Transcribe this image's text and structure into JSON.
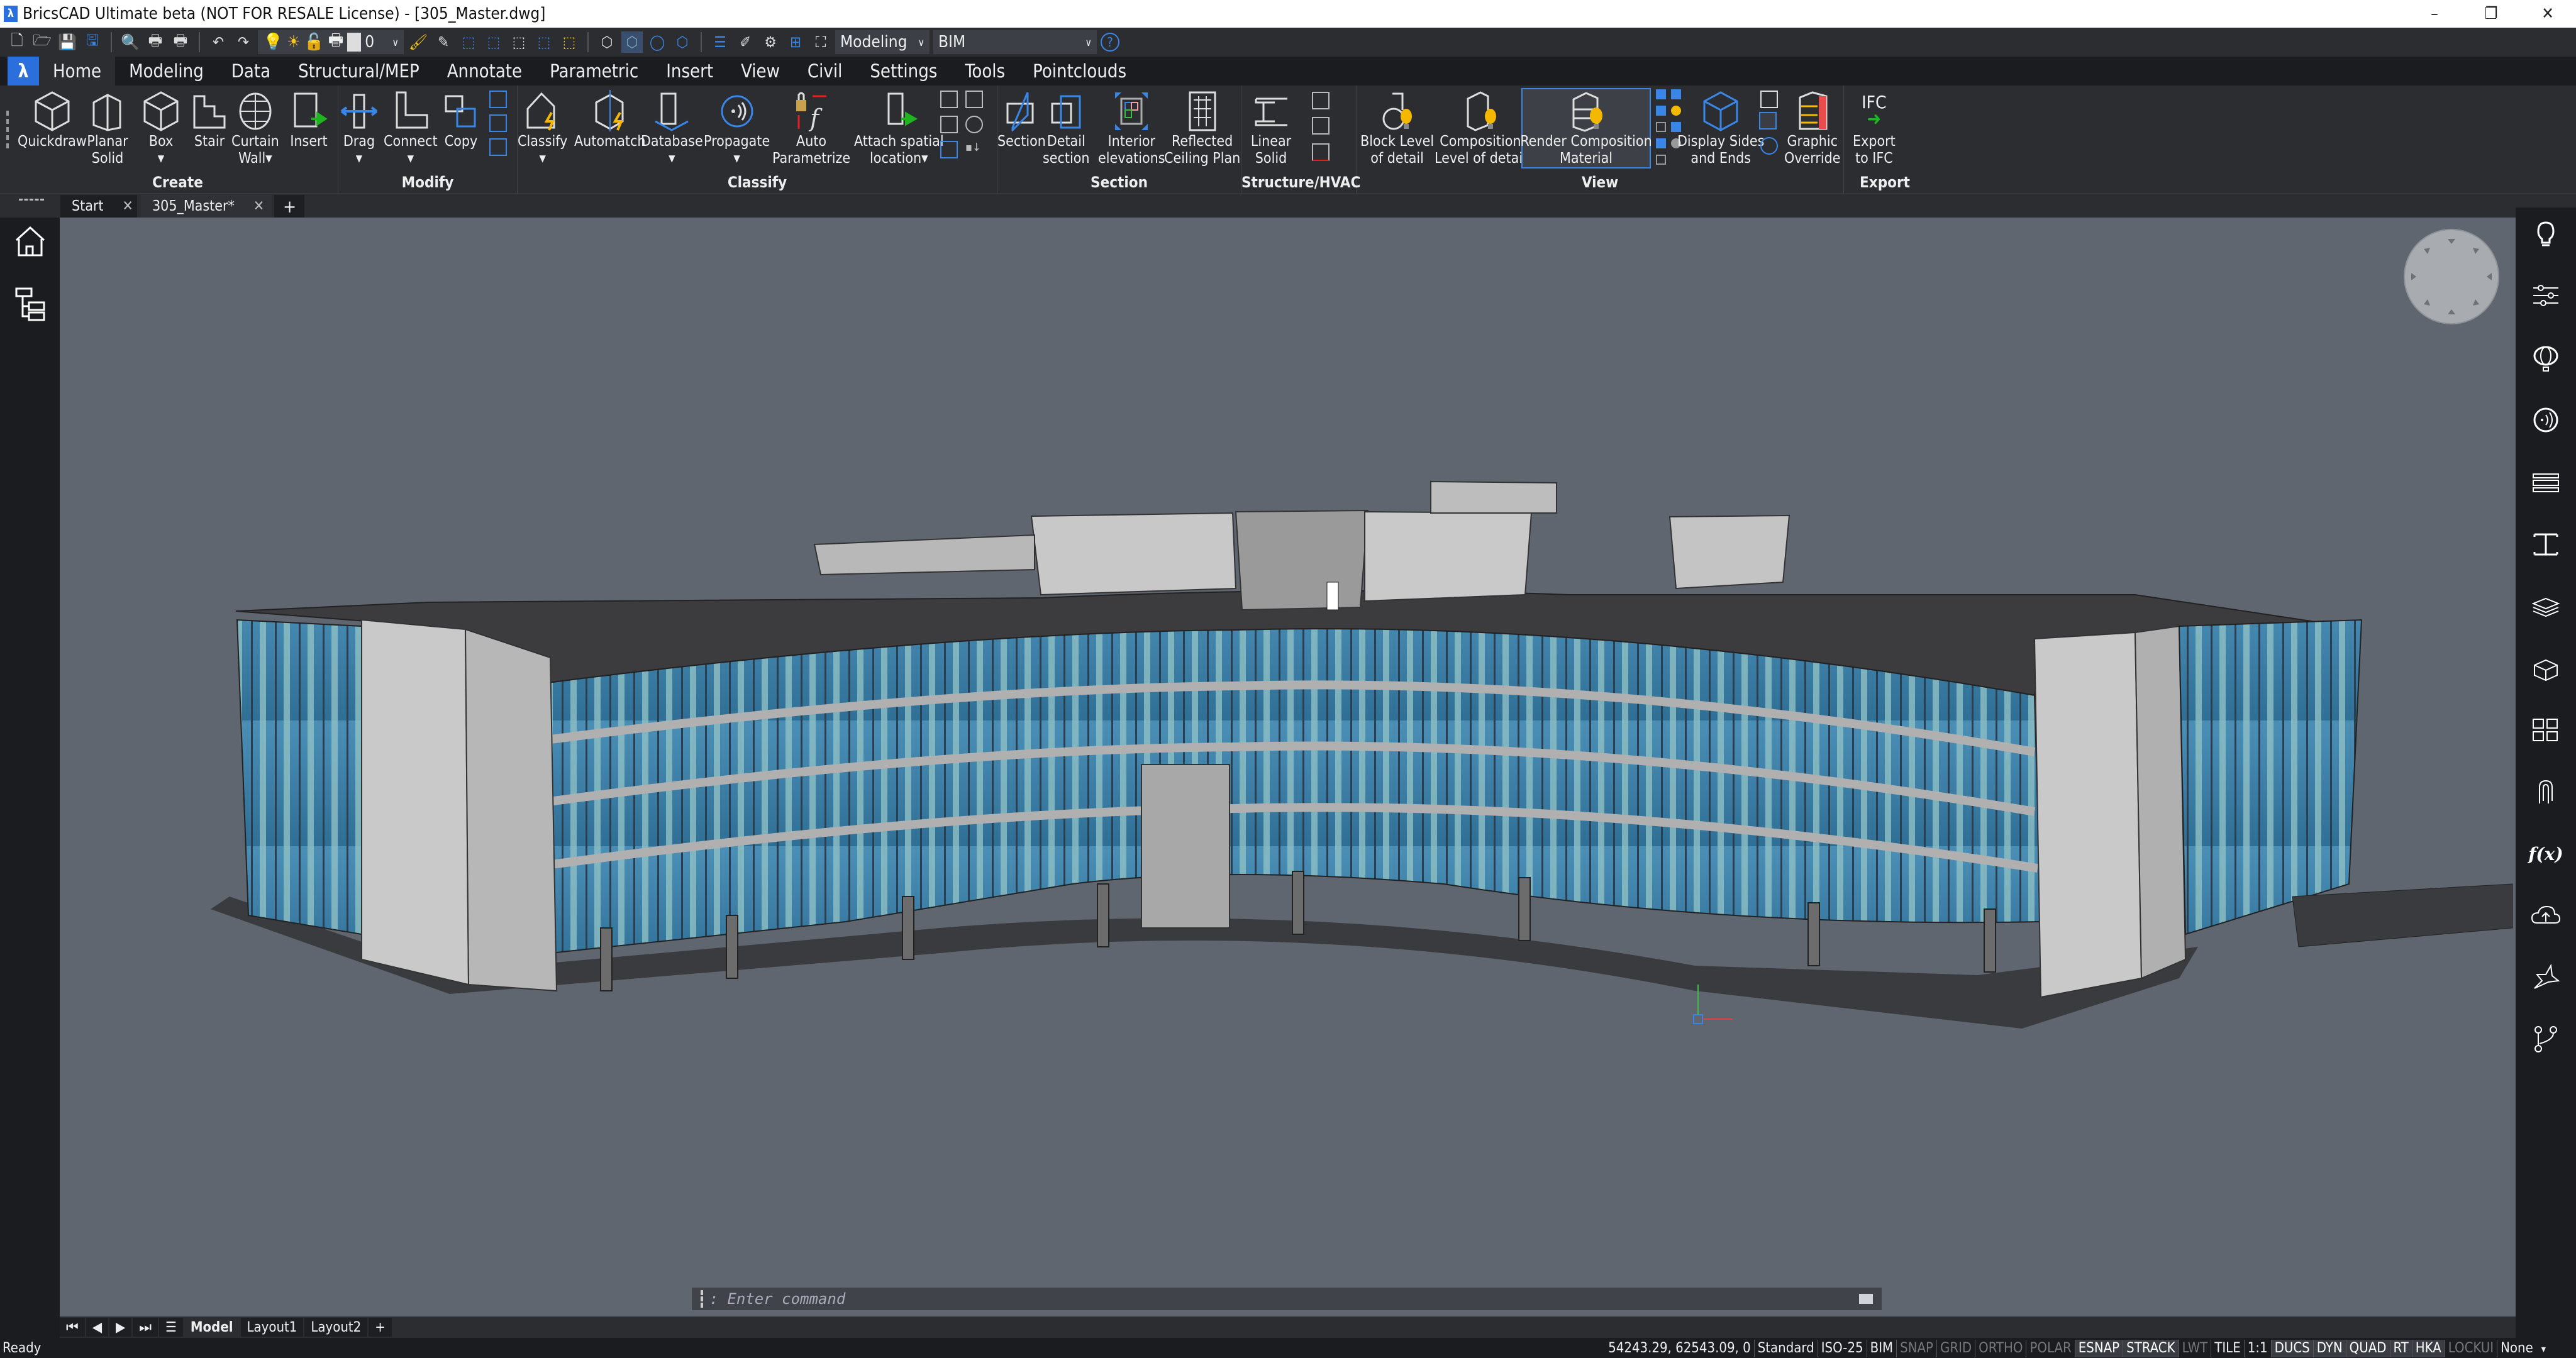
{
  "window": {
    "title": "BricsCAD Ultimate beta (NOT FOR RESALE License) - [305_Master.dwg]",
    "minimize": "–",
    "restore": "❐",
    "close": "✕"
  },
  "quick_access": {
    "layer_value": "0",
    "workspace": "Modeling",
    "profile": "BIM",
    "help": "?"
  },
  "ribbon_tabs": [
    "Home",
    "Modeling",
    "Data",
    "Structural/MEP",
    "Annotate",
    "Parametric",
    "Insert",
    "View",
    "Civil",
    "Settings",
    "Tools",
    "Pointclouds"
  ],
  "ribbon": {
    "create": {
      "title": "Create",
      "tools": [
        {
          "label": "Quickdraw"
        },
        {
          "label": "Planar\nSolid"
        },
        {
          "label": "Box\n▾"
        },
        {
          "label": "Stair"
        },
        {
          "label": "Curtain\nWall▾"
        },
        {
          "label": "Insert"
        }
      ]
    },
    "modify": {
      "title": "Modify",
      "tools": [
        {
          "label": "Drag\n▾"
        },
        {
          "label": "Connect\n▾"
        },
        {
          "label": "Copy"
        }
      ]
    },
    "classify": {
      "title": "Classify",
      "tools": [
        {
          "label": "Classify\n▾"
        },
        {
          "label": "Automatch"
        },
        {
          "label": "Database\n▾"
        },
        {
          "label": "Propagate\n▾"
        },
        {
          "label": "Auto\nParametrize"
        },
        {
          "label": "Attach spatial\nlocation▾"
        }
      ]
    },
    "section": {
      "title": "Section",
      "tools": [
        {
          "label": "Section"
        },
        {
          "label": "Detail\nsection"
        },
        {
          "label": "Interior\nelevations"
        },
        {
          "label": "Reflected\nCeiling Plan"
        }
      ]
    },
    "structure": {
      "title": "Structure/HVAC",
      "tools": [
        {
          "label": "Linear\nSolid"
        }
      ]
    },
    "view": {
      "title": "View",
      "tools": [
        {
          "label": "Block Level\nof detail"
        },
        {
          "label": "Composition\nLevel of detail"
        },
        {
          "label": "Render Composition\nMaterial"
        },
        {
          "label": "Display Sides\nand Ends"
        },
        {
          "label": "Graphic\nOverride"
        }
      ]
    },
    "export": {
      "title": "Export",
      "tools": [
        {
          "label": "Export\nto IFC"
        }
      ],
      "ifc_caption": "IFC"
    }
  },
  "doc_tabs": [
    {
      "label": "Start"
    },
    {
      "label": "305_Master*",
      "active": true
    }
  ],
  "doc_tab_add": "+",
  "command_line": {
    "placeholder": "Enter command"
  },
  "layout_tabs": [
    {
      "label": "Model",
      "active": true
    },
    {
      "label": "Layout1"
    },
    {
      "label": "Layout2"
    }
  ],
  "layout_add": "+",
  "status": {
    "ready": "Ready",
    "coords": "54243.29, 62543.09, 0",
    "items": [
      {
        "label": "Standard",
        "state": "plain"
      },
      {
        "label": "ISO-25",
        "state": "plain"
      },
      {
        "label": "BIM",
        "state": "plain"
      },
      {
        "label": "SNAP",
        "state": "off"
      },
      {
        "label": "GRID",
        "state": "off"
      },
      {
        "label": "ORTHO",
        "state": "off"
      },
      {
        "label": "POLAR",
        "state": "off"
      },
      {
        "label": "ESNAP",
        "state": "on"
      },
      {
        "label": "STRACK",
        "state": "on"
      },
      {
        "label": "LWT",
        "state": "off"
      },
      {
        "label": "TILE",
        "state": "plain"
      },
      {
        "label": "1:1",
        "state": "plain"
      },
      {
        "label": "DUCS",
        "state": "on"
      },
      {
        "label": "DYN",
        "state": "on"
      },
      {
        "label": "QUAD",
        "state": "on"
      },
      {
        "label": "RT",
        "state": "on"
      },
      {
        "label": "HKA",
        "state": "on"
      },
      {
        "label": "LOCKUI",
        "state": "off"
      },
      {
        "label": "None",
        "state": "plain"
      }
    ]
  },
  "colors": {
    "accent": "#2a6fdb",
    "viewport_bg": "#5f6670",
    "panel_bg": "#2b2d31",
    "glass": "#3e86b0"
  }
}
